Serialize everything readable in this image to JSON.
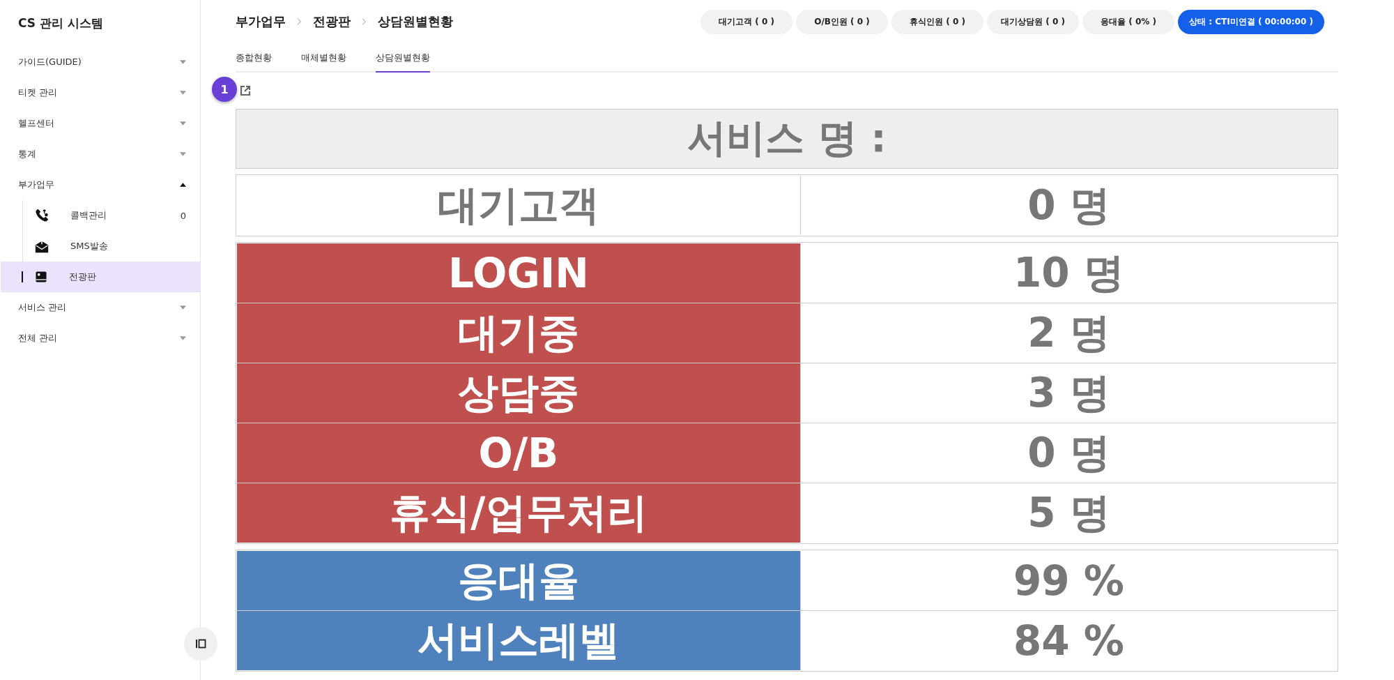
{
  "sidebar": {
    "title": "CS 관리 시스템",
    "items": [
      {
        "label": "가이드(GUIDE)",
        "expanded": false
      },
      {
        "label": "티켓 관리",
        "expanded": false
      },
      {
        "label": "헬프센터",
        "expanded": false
      },
      {
        "label": "통계",
        "expanded": false
      },
      {
        "label": "부가업무",
        "expanded": true,
        "children": [
          {
            "label": "콜백관리",
            "badge": "0",
            "selected": false
          },
          {
            "label": "SMS발송",
            "selected": false
          },
          {
            "label": "전광판",
            "selected": true
          }
        ]
      },
      {
        "label": "서비스 관리",
        "expanded": false
      },
      {
        "label": "전체 관리",
        "expanded": false
      }
    ]
  },
  "breadcrumb": [
    "부가업무",
    "전광판",
    "상담원별현황"
  ],
  "status_chips": [
    {
      "label": "대기고객 ( 0 )",
      "kind": "plain"
    },
    {
      "label": "O/B인원 ( 0 )",
      "kind": "plain"
    },
    {
      "label": "휴식인원 ( 0 )",
      "kind": "plain"
    },
    {
      "label": "대기상담원 ( 0 )",
      "kind": "plain"
    },
    {
      "label": "응대율 ( 0% )",
      "kind": "plain"
    },
    {
      "label": "상태 : CTI미연결 ( 00:00:00 )",
      "kind": "primary"
    }
  ],
  "tabs": [
    {
      "label": "종합현황",
      "selected": false
    },
    {
      "label": "매체별현황",
      "selected": false
    },
    {
      "label": "상담원별현황",
      "selected": true
    }
  ],
  "step_badge": "1",
  "board": {
    "title": "서비스 명 :",
    "sections": [
      {
        "kind": "plain",
        "rows": [
          {
            "label": "대기고객",
            "value": "0 명"
          }
        ]
      },
      {
        "kind": "red",
        "rows": [
          {
            "label": "LOGIN",
            "value": "10 명"
          },
          {
            "label": "대기중",
            "value": "2 명"
          },
          {
            "label": "상담중",
            "value": "3 명"
          },
          {
            "label": "O/B",
            "value": "0 명"
          },
          {
            "label": "휴식/업무처리",
            "value": "5 명"
          }
        ]
      },
      {
        "kind": "blue",
        "rows": [
          {
            "label": "응대율",
            "value": "99 %"
          },
          {
            "label": "서비스레벨",
            "value": "84 %"
          }
        ]
      }
    ]
  }
}
